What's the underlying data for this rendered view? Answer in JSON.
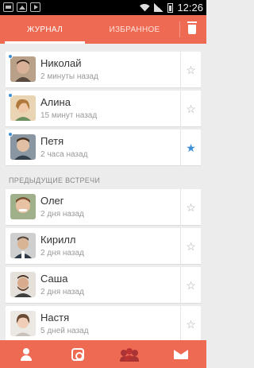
{
  "tabs": {
    "journal": "ЖУРНАЛ",
    "favorites": "ИЗБРАННОЕ"
  },
  "status": {
    "time": "12:26"
  },
  "recent": [
    {
      "name": "Николай",
      "time": "2 минуты назад",
      "starred": false,
      "new": true
    },
    {
      "name": "Алина",
      "time": "15 минут назад",
      "starred": false,
      "new": true
    },
    {
      "name": "Петя",
      "time": "2 часа назад",
      "starred": true,
      "new": true
    }
  ],
  "previous_title": "ПРЕДЫДУЩИЕ ВСТРЕЧИ",
  "previous": [
    {
      "name": "Олег",
      "time": "2 дня назад",
      "starred": false
    },
    {
      "name": "Кирилл",
      "time": "2 дня назад",
      "starred": false
    },
    {
      "name": "Саша",
      "time": "2 дня назад",
      "starred": false
    },
    {
      "name": "Настя",
      "time": "5 дней назад",
      "starred": false
    }
  ],
  "colors": {
    "accent": "#ee6a53",
    "star_active": "#3b8ed8",
    "background": "#ececec"
  },
  "icons": {
    "bottom": [
      "person-icon",
      "profile-card-icon",
      "group-icon",
      "mail-icon"
    ],
    "trash": "trash-icon",
    "star": "star-icon"
  }
}
